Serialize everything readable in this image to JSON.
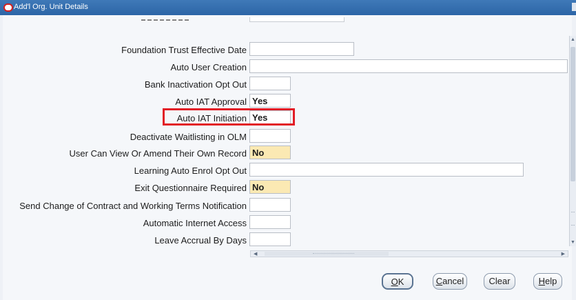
{
  "window": {
    "title": "Add'l Org. Unit Details"
  },
  "fields": [
    {
      "label": "Foundation Trust Effective Date",
      "value": "",
      "required": false
    },
    {
      "label": "Auto User Creation",
      "value": "",
      "required": false
    },
    {
      "label": "Bank Inactivation Opt Out",
      "value": "",
      "required": false
    },
    {
      "label": "Auto IAT Approval",
      "value": "Yes",
      "required": false
    },
    {
      "label": "Auto IAT Initiation",
      "value": "Yes",
      "required": false
    },
    {
      "label": "Deactivate Waitlisting in OLM",
      "value": "",
      "required": false
    },
    {
      "label": "User Can View Or Amend Their Own Record",
      "value": "No",
      "required": true
    },
    {
      "label": "Learning Auto Enrol Opt Out",
      "value": "",
      "required": false
    },
    {
      "label": "Exit Questionnaire Required",
      "value": "No",
      "required": true
    },
    {
      "label": "Send Change of Contract and Working Terms Notification",
      "value": "",
      "required": false
    },
    {
      "label": "Automatic Internet Access",
      "value": "",
      "required": false
    },
    {
      "label": "Leave Accrual By Days",
      "value": "",
      "required": false
    }
  ],
  "highlighted_field": "Auto IAT Initiation",
  "colors": {
    "titlebar": "#2c65a6",
    "required_field": "#fbe9b3",
    "highlight_box": "#e21c25"
  },
  "buttons": {
    "ok": {
      "mnemonic": "O",
      "rest": "K"
    },
    "cancel": {
      "mnemonic": "C",
      "rest": "ancel"
    },
    "clear": {
      "label": "Clear"
    },
    "help": {
      "mnemonic": "H",
      "rest": "elp"
    }
  }
}
